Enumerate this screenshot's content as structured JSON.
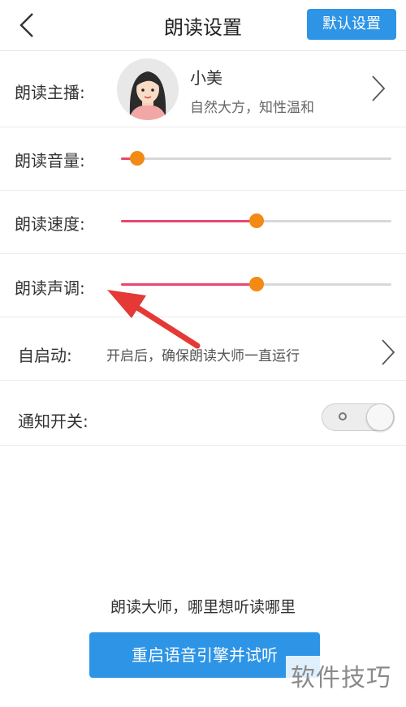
{
  "header": {
    "title": "朗读设置",
    "default_button": "默认设置",
    "back_icon": "chevron-left-icon"
  },
  "anchor": {
    "label": "朗读主播:",
    "name": "小美",
    "description": "自然大方，知性温和"
  },
  "volume": {
    "label": "朗读音量:",
    "value": 0.06
  },
  "speed": {
    "label": "朗读速度:",
    "value": 0.5
  },
  "pitch": {
    "label": "朗读声调:",
    "value": 0.5
  },
  "autostart": {
    "label": "自启动:",
    "description": "开启后，确保朗读大师一直运行"
  },
  "notify": {
    "label": "通知开关:",
    "enabled": false
  },
  "footer": {
    "slogan": "朗读大师，哪里想听读哪里",
    "restart_button": "重启语音引擎并试听"
  },
  "watermark": "软件技巧",
  "colors": {
    "accent_blue": "#2d94e6",
    "slider_fill": "#e8466e",
    "slider_thumb": "#f28a14",
    "annotation_arrow": "#e53935"
  }
}
